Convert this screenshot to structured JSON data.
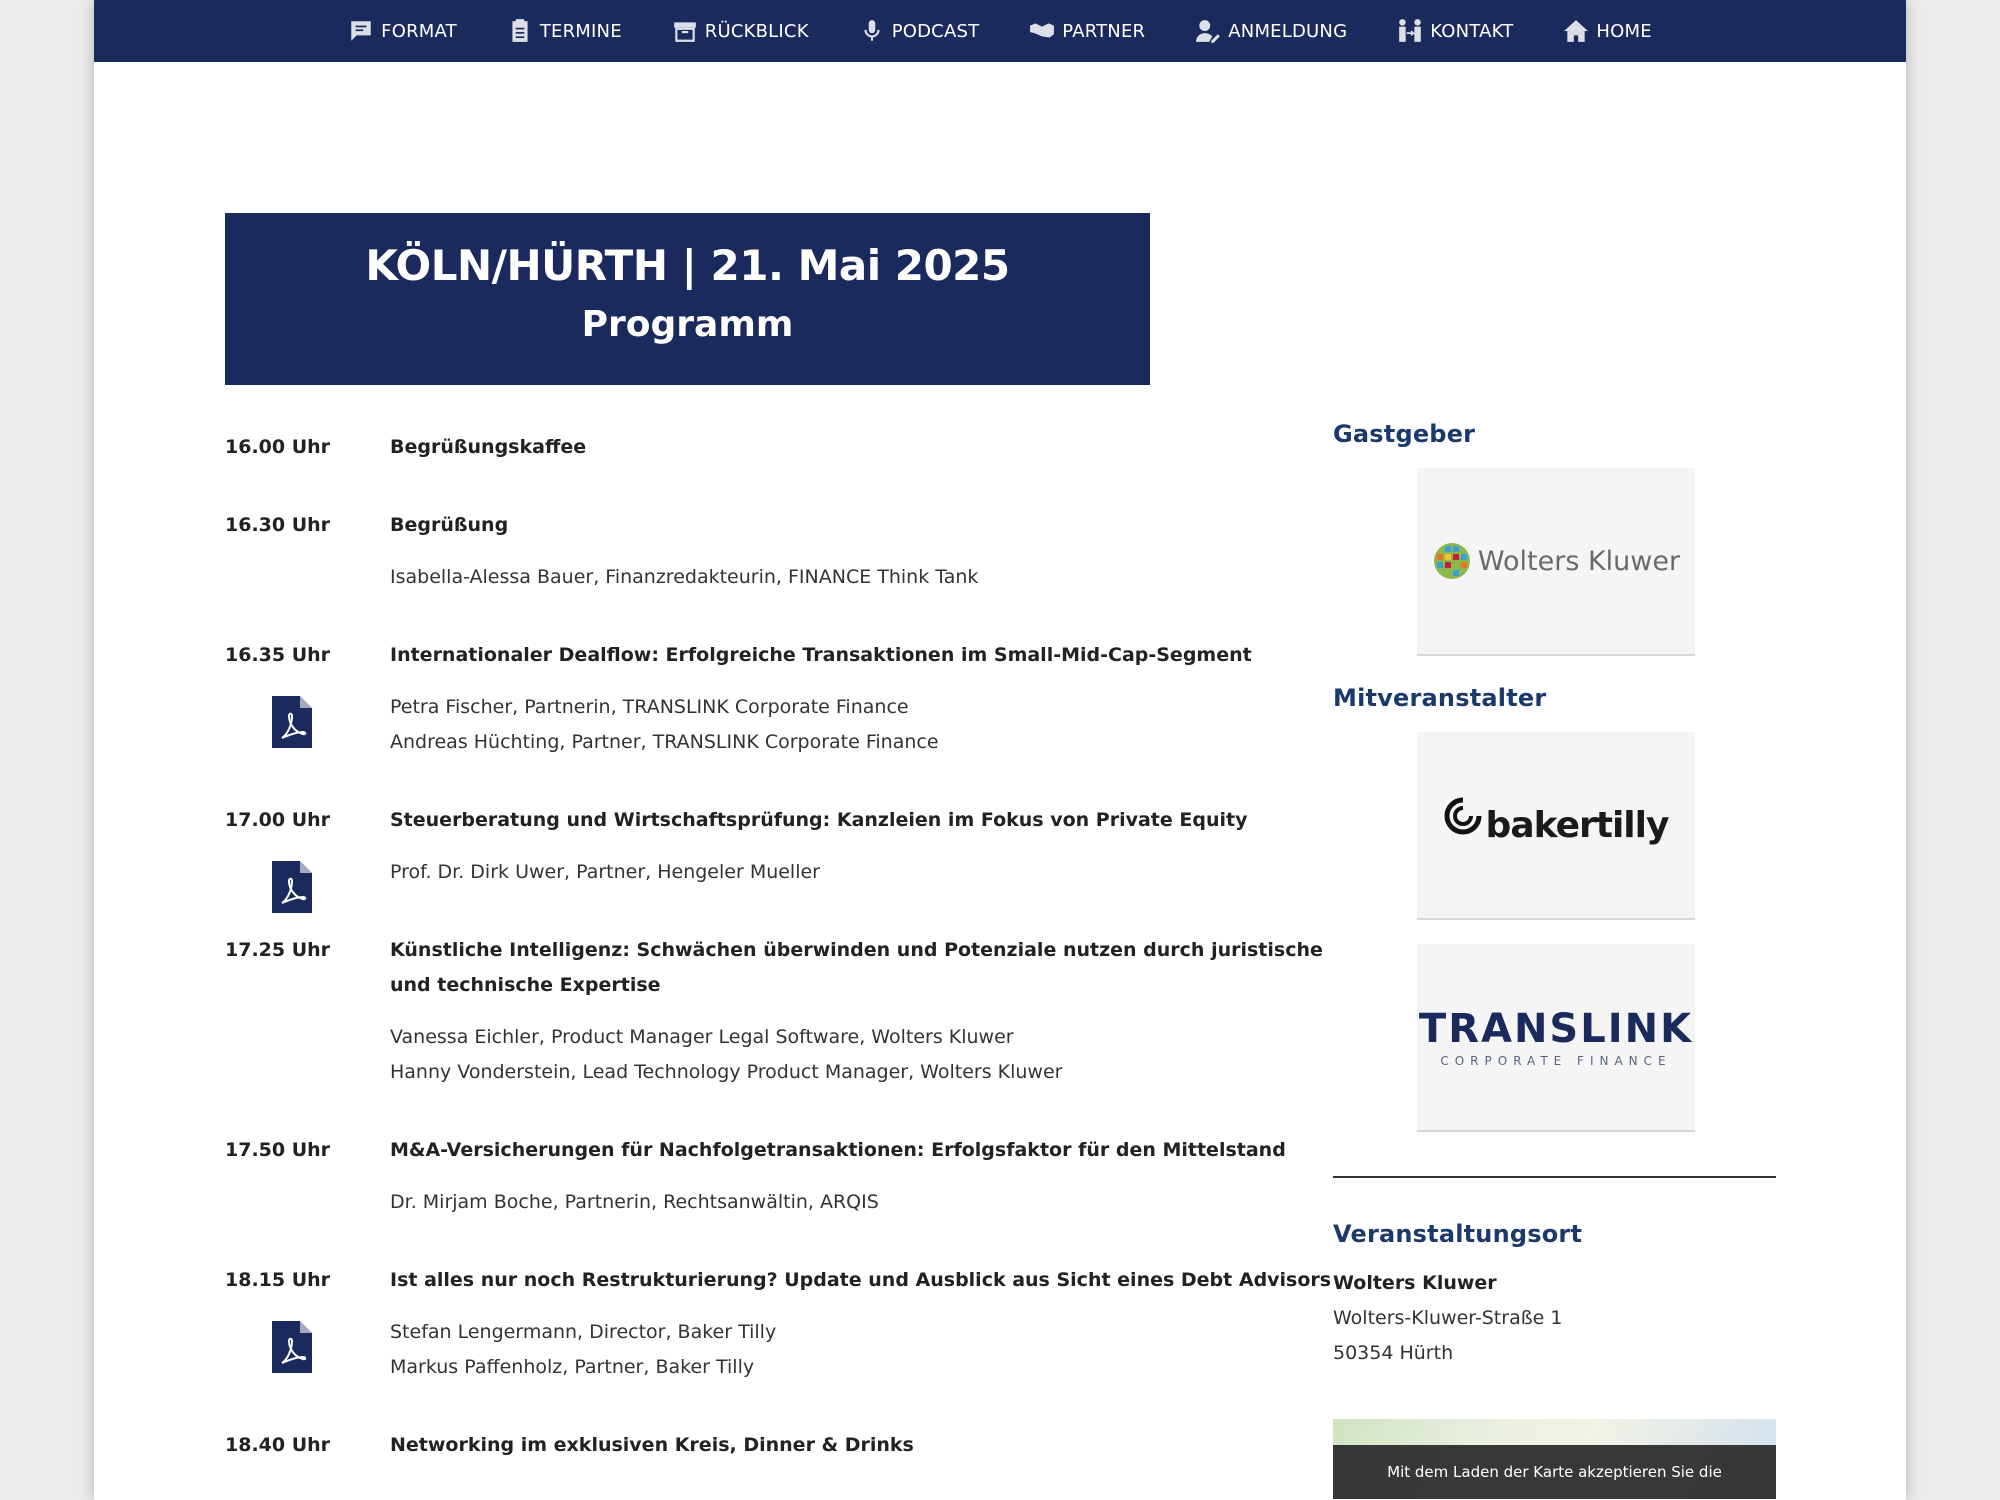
{
  "nav": {
    "items": [
      {
        "label": "FORMAT",
        "icon": "speech-bubble-icon"
      },
      {
        "label": "TERMINE",
        "icon": "clipboard-icon"
      },
      {
        "label": "RÜCKBLICK",
        "icon": "archive-box-icon"
      },
      {
        "label": "PODCAST",
        "icon": "microphone-icon"
      },
      {
        "label": "PARTNER",
        "icon": "handshake-icon"
      },
      {
        "label": "ANMELDUNG",
        "icon": "user-pencil-icon"
      },
      {
        "label": "KONTAKT",
        "icon": "people-arrows-icon"
      },
      {
        "label": "HOME",
        "icon": "house-icon"
      }
    ]
  },
  "hero": {
    "title": "KÖLN/HÜRTH | 21. Mai 2025",
    "subtitle": "Programm"
  },
  "programme": [
    {
      "time": "16.00 Uhr",
      "title": "Begrüßungskaffee",
      "speakers": []
    },
    {
      "time": "16.30 Uhr",
      "title": "Begrüßung",
      "speakers": [
        "Isabella-Alessa Bauer, Finanzredakteurin, FINANCE Think Tank"
      ]
    },
    {
      "time": "16.35 Uhr",
      "title": "Internationaler Dealflow: Erfolgreiche Transaktionen im Small-Mid-Cap-Segment",
      "speakers": [
        "Petra Fischer, Partnerin, TRANSLINK Corporate Finance",
        "Andreas Hüchting, Partner, TRANSLINK Corporate Finance"
      ]
    },
    {
      "time": "17.00 Uhr",
      "title": "Steuerberatung und Wirtschaftsprüfung: Kanzleien im Fokus von Private Equity",
      "speakers": [
        "Prof. Dr. Dirk Uwer, Partner, Hengeler Mueller"
      ]
    },
    {
      "time": "17.25 Uhr",
      "title": "Künstliche Intelligenz: Schwächen überwinden und Potenziale nutzen durch juristische und technische Expertise",
      "speakers": [
        "Vanessa Eichler, Product Manager Legal Software, Wolters Kluwer",
        "Hanny Vonderstein, Lead Technology Product Manager, Wolters Kluwer"
      ]
    },
    {
      "time": "17.50 Uhr",
      "title": "M&A-Versicherungen für Nachfolgetransaktionen: Erfolgsfaktor für den Mittelstand",
      "speakers": [
        "Dr. Mirjam Boche, Partnerin, Rechtsanwältin, ARQIS"
      ]
    },
    {
      "time": "18.15 Uhr",
      "title": "Ist alles nur noch Restrukturierung? Update und Ausblick aus Sicht eines Debt Advisors",
      "speakers": [
        "Stefan Lengermann, Director, Baker Tilly",
        "Markus Paffenholz, Partner, Baker Tilly"
      ]
    },
    {
      "time": "18.40 Uhr",
      "title": "Networking im exklusiven Kreis, Dinner & Drinks",
      "speakers": []
    }
  ],
  "sidebar": {
    "host_heading": "Gastgeber",
    "host_logo_text": "Wolters Kluwer",
    "coorganizer_heading": "Mitveranstalter",
    "coorganizer_logo1_text": "bakertilly",
    "coorganizer_logo2_text": "TRANSLINK",
    "coorganizer_logo2_sub": "CORPORATE FINANCE",
    "venue_heading": "Veranstaltungsort",
    "venue_name": "Wolters Kluwer",
    "venue_street": "Wolters-Kluwer-Straße 1",
    "venue_city": "50354 Hürth",
    "map_note": "Mit dem Laden der Karte akzeptieren Sie die"
  },
  "colors": {
    "navy": "#1b2a5c",
    "heading_blue": "#1b3a6b",
    "translink_orange": "#e8742c"
  }
}
